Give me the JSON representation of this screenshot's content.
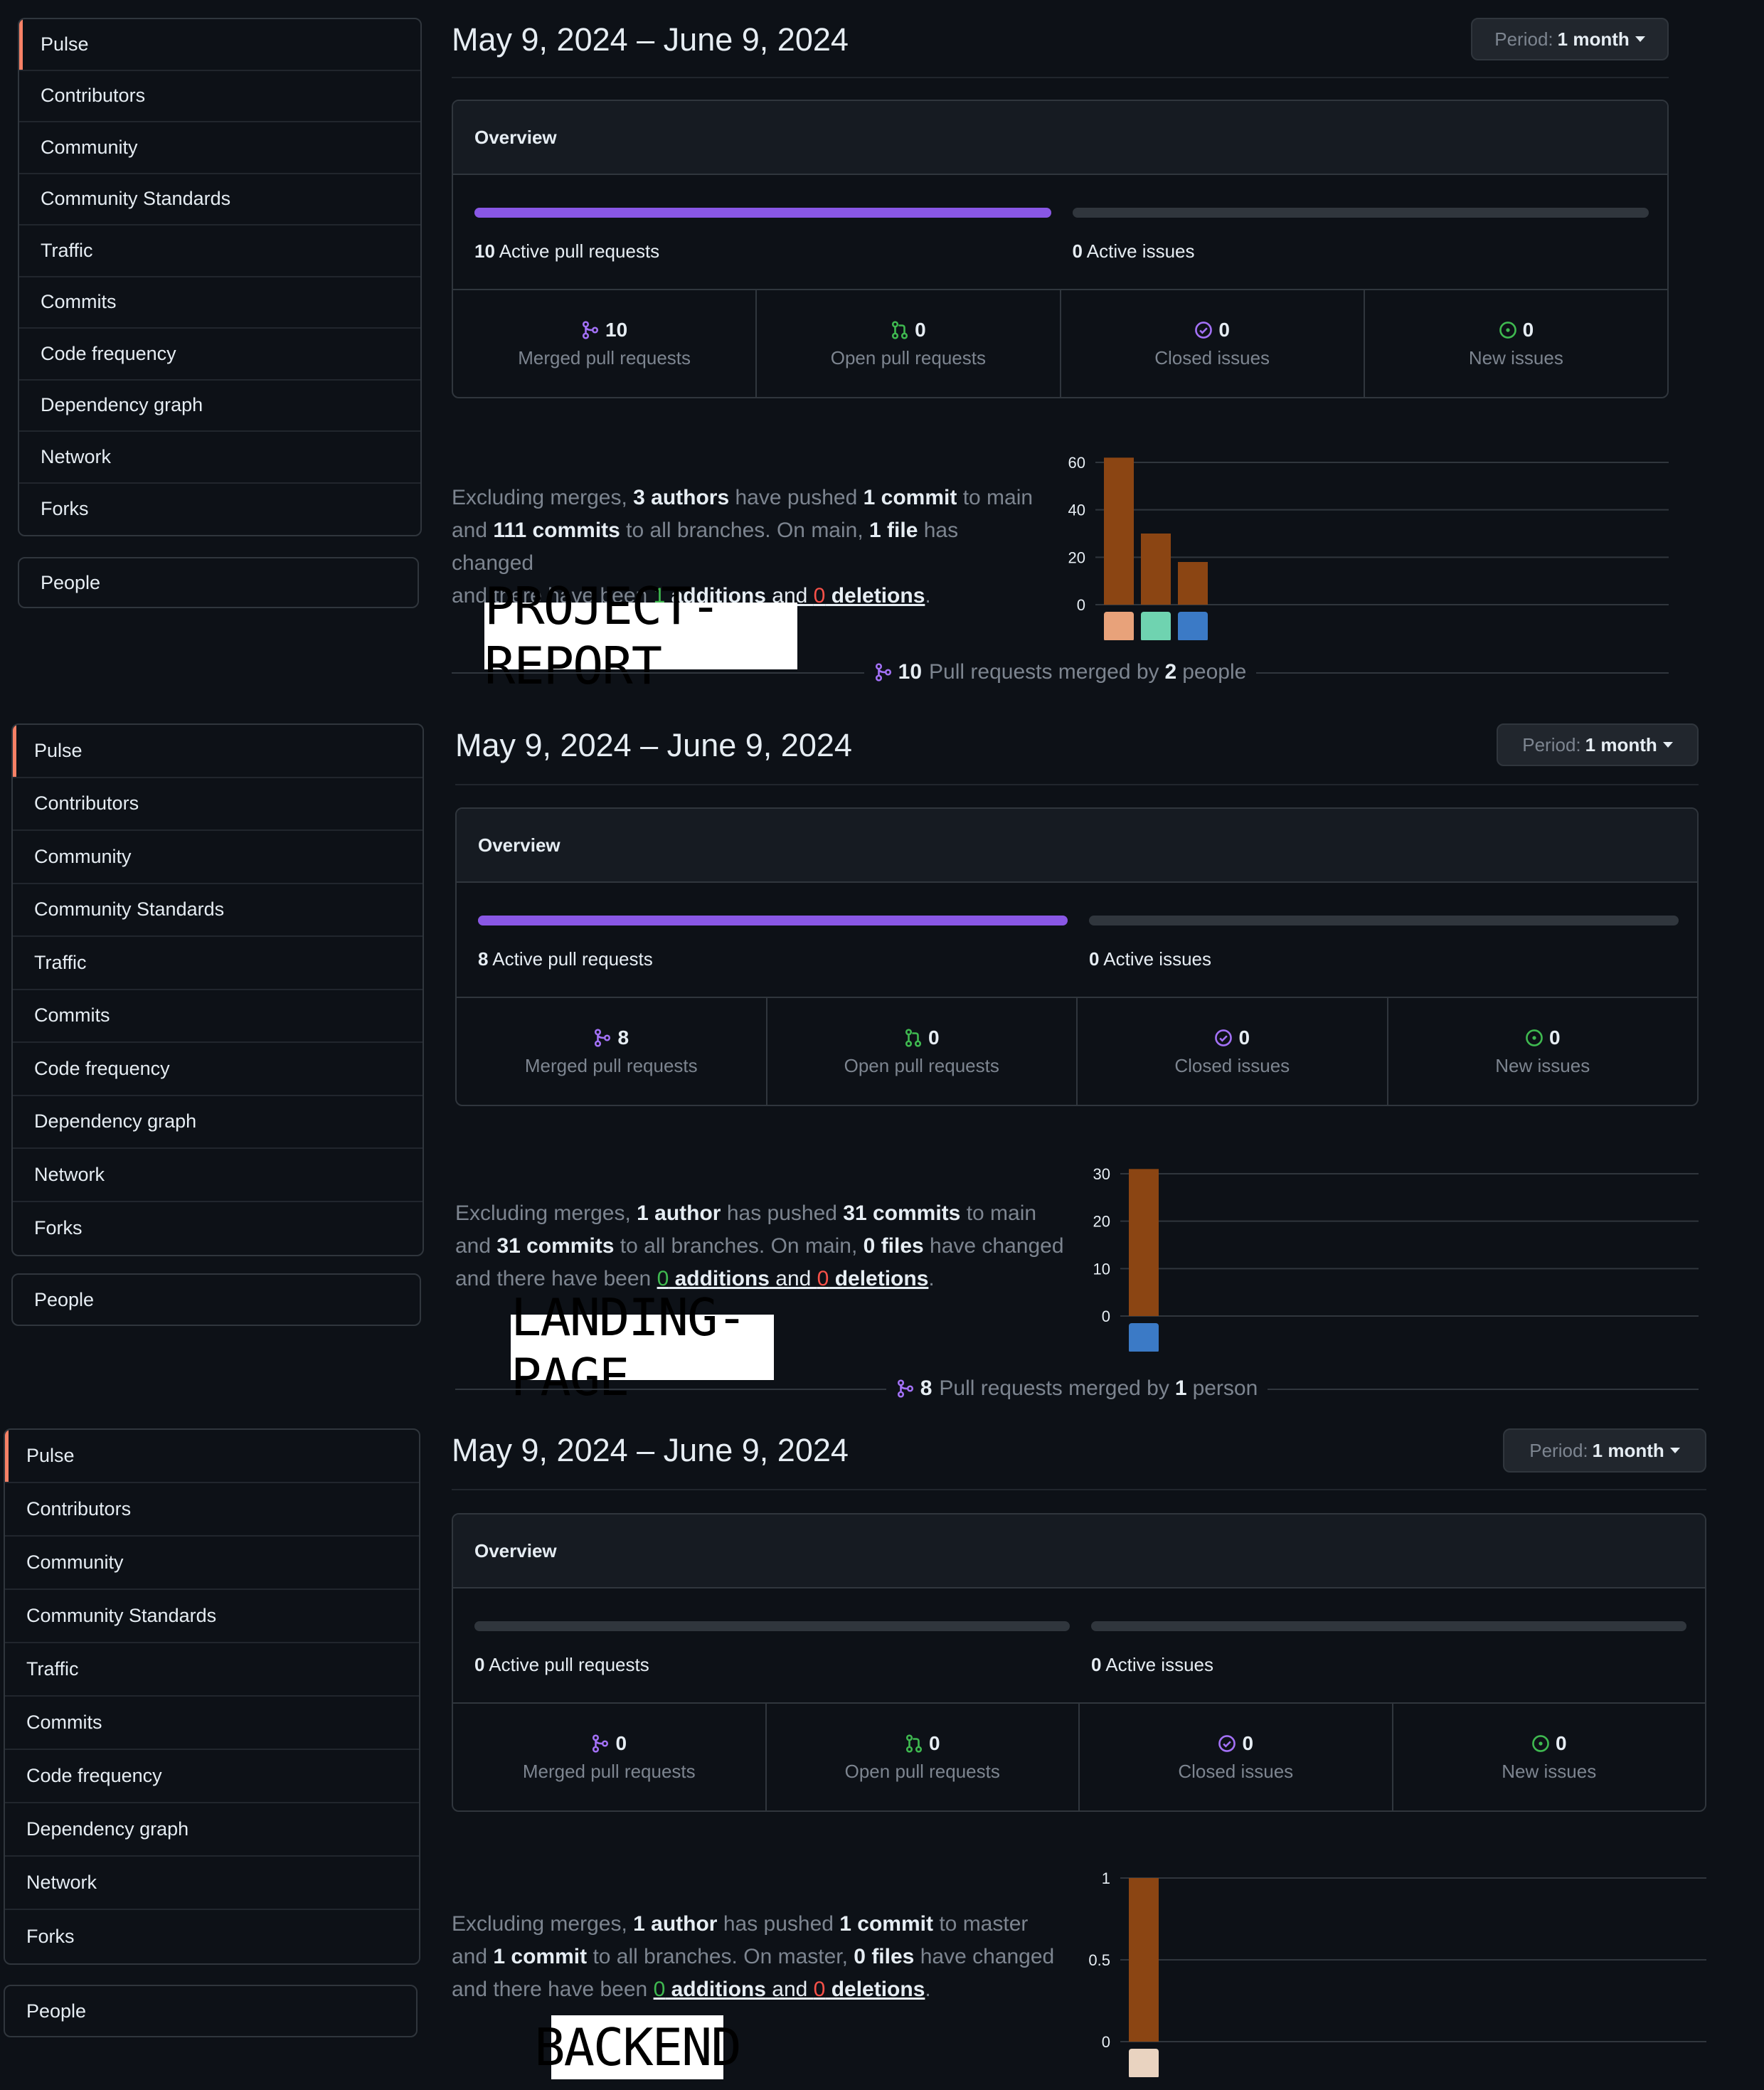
{
  "sidebar_items": [
    "Pulse",
    "Contributors",
    "Community",
    "Community Standards",
    "Traffic",
    "Commits",
    "Code frequency",
    "Dependency graph",
    "Network",
    "Forks"
  ],
  "people_label": "People",
  "period": {
    "prefix": "Period:",
    "value": "1 month"
  },
  "overview_label": "Overview",
  "colors": {
    "accent_pr": "#8957e5",
    "bar": "#8b4513",
    "open": "#3fb950",
    "closed": "#a371f7",
    "issue": "#3fb950"
  },
  "panels": [
    {
      "date_range": "May 9, 2024 – June 9, 2024",
      "active_pr_count": "10",
      "active_pr_label": "Active pull requests",
      "active_pr_fill": 1.0,
      "active_issue_count": "0",
      "active_issue_label": "Active issues",
      "active_issue_fill": 0,
      "stats": [
        {
          "value": "10",
          "label": "Merged pull requests",
          "icon": "merge-icon"
        },
        {
          "value": "0",
          "label": "Open pull requests",
          "icon": "pr-open-icon"
        },
        {
          "value": "0",
          "label": "Closed issues",
          "icon": "issue-closed-icon"
        },
        {
          "value": "0",
          "label": "New issues",
          "icon": "issue-open-icon"
        }
      ],
      "summary": {
        "t1": "Excluding merges, ",
        "b1": "3 authors",
        "t2": " have pushed ",
        "b2": "1 commit",
        "t3": " to main",
        "t4": "and ",
        "b3": "111 commits",
        "t5": " to all branches. On main, ",
        "b4": "1 file",
        "t6": " has changed",
        "t7": "and there have been ",
        "add": "1",
        "add_label": " additions",
        "and": " and ",
        "del": "0",
        "del_label": " deletions",
        "end": "."
      },
      "label": "PROJECT-REPORT",
      "merged": {
        "count": "10",
        "text": "Pull requests merged by",
        "people": "2",
        "people_label": "people"
      },
      "chart_data": {
        "type": "bar",
        "categories": [
          "author-1",
          "author-2",
          "author-3"
        ],
        "values": [
          62,
          30,
          18
        ],
        "ylim": [
          0,
          60
        ],
        "yticks": [
          "60",
          "40",
          "20",
          "0"
        ]
      }
    },
    {
      "date_range": "May 9, 2024 – June 9, 2024",
      "active_pr_count": "8",
      "active_pr_label": "Active pull requests",
      "active_pr_fill": 1.0,
      "active_issue_count": "0",
      "active_issue_label": "Active issues",
      "active_issue_fill": 0,
      "stats": [
        {
          "value": "8",
          "label": "Merged pull requests",
          "icon": "merge-icon"
        },
        {
          "value": "0",
          "label": "Open pull requests",
          "icon": "pr-open-icon"
        },
        {
          "value": "0",
          "label": "Closed issues",
          "icon": "issue-closed-icon"
        },
        {
          "value": "0",
          "label": "New issues",
          "icon": "issue-open-icon"
        }
      ],
      "summary": {
        "t1": "Excluding merges, ",
        "b1": "1 author",
        "t2": " has pushed ",
        "b2": "31 commits",
        "t3": " to main",
        "t4": "and ",
        "b3": "31 commits",
        "t5": " to all branches. On main, ",
        "b4": "0 files",
        "t6": " have changed",
        "t7": "and there have been ",
        "add": "0",
        "add_label": " additions",
        "and": " and ",
        "del": "0",
        "del_label": " deletions",
        "end": "."
      },
      "label": "LANDING-PAGE",
      "merged": {
        "count": "8",
        "text": "Pull requests merged by",
        "people": "1",
        "people_label": "person"
      },
      "chart_data": {
        "type": "bar",
        "categories": [
          "author-1"
        ],
        "values": [
          31
        ],
        "ylim": [
          0,
          30
        ],
        "yticks": [
          "30",
          "20",
          "10",
          "0"
        ]
      }
    },
    {
      "date_range": "May 9, 2024 – June 9, 2024",
      "active_pr_count": "0",
      "active_pr_label": "Active pull requests",
      "active_pr_fill": 0,
      "active_issue_count": "0",
      "active_issue_label": "Active issues",
      "active_issue_fill": 0,
      "stats": [
        {
          "value": "0",
          "label": "Merged pull requests",
          "icon": "merge-icon"
        },
        {
          "value": "0",
          "label": "Open pull requests",
          "icon": "pr-open-icon"
        },
        {
          "value": "0",
          "label": "Closed issues",
          "icon": "issue-closed-icon"
        },
        {
          "value": "0",
          "label": "New issues",
          "icon": "issue-open-icon"
        }
      ],
      "summary": {
        "t1": "Excluding merges, ",
        "b1": "1 author",
        "t2": " has pushed ",
        "b2": "1 commit",
        "t3": " to master",
        "t4": "and ",
        "b3": "1 commit",
        "t5": " to all branches. On master, ",
        "b4": "0 files",
        "t6": " have changed",
        "t7": "and there have been ",
        "add": "0",
        "add_label": " additions",
        "and": " and ",
        "del": "0",
        "del_label": " deletions",
        "end": "."
      },
      "label": "BACKEND",
      "merged": null,
      "chart_data": {
        "type": "bar",
        "categories": [
          "author-1"
        ],
        "values": [
          1
        ],
        "ylim": [
          0,
          1
        ],
        "yticks": [
          "1",
          "0.5",
          "0"
        ]
      }
    }
  ]
}
